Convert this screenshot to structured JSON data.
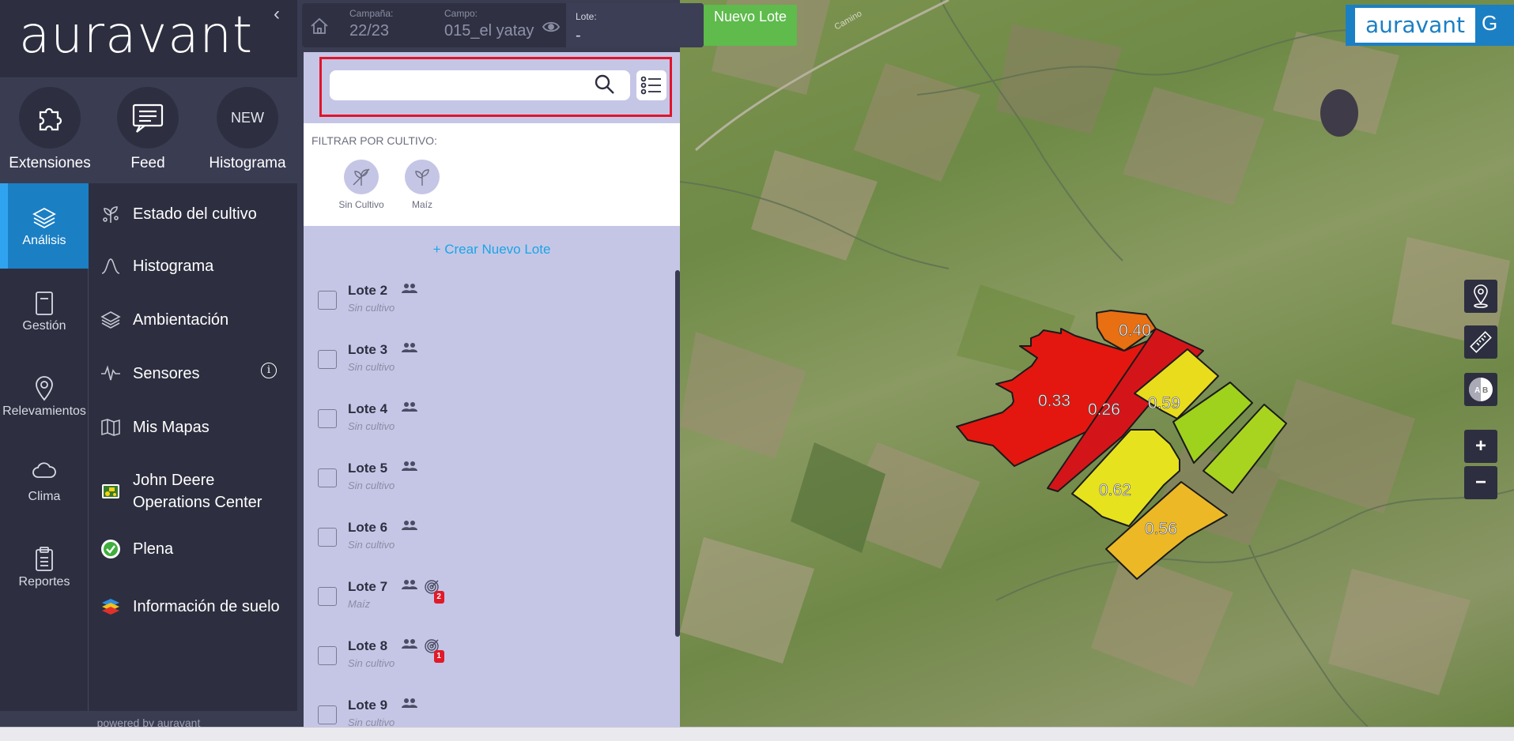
{
  "brand": {
    "logo_text": "auravant",
    "collapse_glyph": "‹"
  },
  "quick_actions": [
    {
      "label": "Extensiones",
      "icon": "puzzle-icon"
    },
    {
      "label": "Feed",
      "icon": "chat-icon"
    },
    {
      "label": "Histograma",
      "icon_text": "NEW"
    }
  ],
  "rail": [
    {
      "label": "Análisis",
      "icon": "layers-icon",
      "active": true
    },
    {
      "label": "Gestión",
      "icon": "notebook-icon"
    },
    {
      "label": "Relevamientos",
      "icon": "map-pin-icon"
    },
    {
      "label": "Clima",
      "icon": "cloud-icon"
    },
    {
      "label": "Reportes",
      "icon": "clipboard-icon"
    }
  ],
  "menu": [
    {
      "label": "Estado del cultivo",
      "icon": "plant-icon"
    },
    {
      "label": "Histograma",
      "icon": "bell-curve-icon"
    },
    {
      "label": "Ambientación",
      "icon": "layers-icon"
    },
    {
      "label": "Sensores",
      "icon": "pulse-icon",
      "info": "i"
    },
    {
      "label": "Mis Mapas",
      "icon": "folded-map-icon"
    },
    {
      "label": "John Deere Operations Center",
      "icon": "tractor-icon"
    },
    {
      "label": "Plena",
      "icon": "check-circle-icon"
    },
    {
      "label": "Información de suelo",
      "icon": "stacked-layers-icon"
    }
  ],
  "powered_by": "powered by auravant",
  "topbar": {
    "campaign_caption": "Campaña:",
    "campaign_value": "22/23",
    "field_caption": "Campo:",
    "field_value": "015_el yatay",
    "lote_caption": "Lote:",
    "lote_value": "-",
    "new_lote_label": "Nuevo Lote"
  },
  "search": {
    "placeholder": "",
    "value": ""
  },
  "filter": {
    "title": "FILTRAR POR CULTIVO:",
    "crops": [
      {
        "label": "Sin Cultivo"
      },
      {
        "label": "Maíz"
      }
    ]
  },
  "create_lote_label": "+  Crear Nuevo Lote",
  "lotes": [
    {
      "name": "Lote 2",
      "crop": "Sin cultivo"
    },
    {
      "name": "Lote 3",
      "crop": "Sin cultivo"
    },
    {
      "name": "Lote 4",
      "crop": "Sin cultivo"
    },
    {
      "name": "Lote 5",
      "crop": "Sin cultivo"
    },
    {
      "name": "Lote 6",
      "crop": "Sin cultivo"
    },
    {
      "name": "Lote 7",
      "crop": "Maíz",
      "badge": "2"
    },
    {
      "name": "Lote 8",
      "crop": "Sin cultivo",
      "badge": "1"
    },
    {
      "name": "Lote 9",
      "crop": "Sin cultivo"
    }
  ],
  "map": {
    "road_label": "Camino",
    "field_values": [
      "0.40",
      "0.33",
      "0.26",
      "0.59",
      "0.62",
      "0.56"
    ],
    "brand_logo": "auravant",
    "user_initial": "G",
    "zoom_in": "+",
    "zoom_out": "−",
    "colors": {
      "red": "#e3170f",
      "orange": "#e86f12",
      "yellow": "#e9dc1c",
      "light_green": "#9ed21d",
      "gold": "#ecb825"
    }
  }
}
